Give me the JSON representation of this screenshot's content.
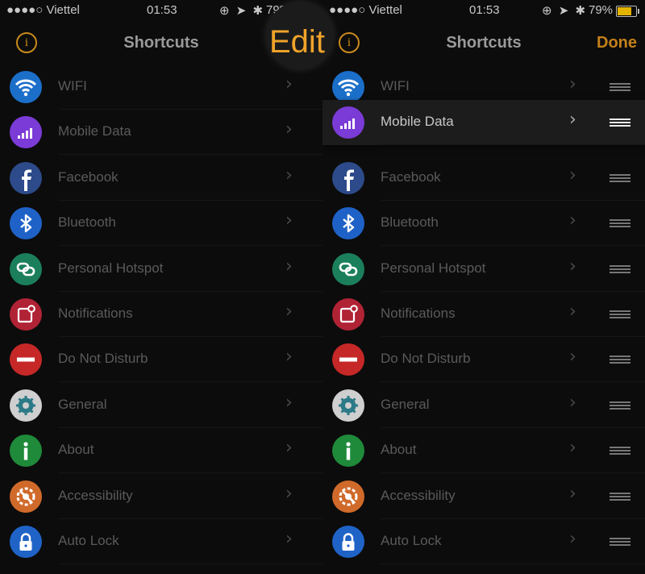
{
  "status": {
    "carrier": "●●●●○ Viettel",
    "time": "01:53",
    "battery": "79%",
    "icons": "⊕ ➤ ✱"
  },
  "left": {
    "title": "Shortcuts",
    "info": "i",
    "edit": "Edit"
  },
  "right": {
    "title": "Shortcuts",
    "info": "i",
    "done": "Done"
  },
  "items": [
    {
      "label": "WIFI",
      "icon": "wifi-icon",
      "color": "#1b6fc9"
    },
    {
      "label": "Mobile Data",
      "icon": "mobile-data-icon",
      "color": "#7b3bd6"
    },
    {
      "label": "Facebook",
      "icon": "facebook-icon",
      "color": "#2d4b8a"
    },
    {
      "label": "Bluetooth",
      "icon": "bluetooth-icon",
      "color": "#1f62c7"
    },
    {
      "label": "Personal Hotspot",
      "icon": "hotspot-icon",
      "color": "#1c7f5c"
    },
    {
      "label": "Notifications",
      "icon": "notifications-icon",
      "color": "#b02335"
    },
    {
      "label": "Do Not Disturb",
      "icon": "do-not-disturb-icon",
      "color": "#c62828"
    },
    {
      "label": "General",
      "icon": "gear-icon",
      "color": "#cfcfcf"
    },
    {
      "label": "About",
      "icon": "info-icon",
      "color": "#1f8a3a"
    },
    {
      "label": "Accessibility",
      "icon": "accessibility-icon",
      "color": "#d06a2a"
    },
    {
      "label": "Auto Lock",
      "icon": "lock-icon",
      "color": "#1f63c7"
    }
  ],
  "dragging_item": "Mobile Data"
}
